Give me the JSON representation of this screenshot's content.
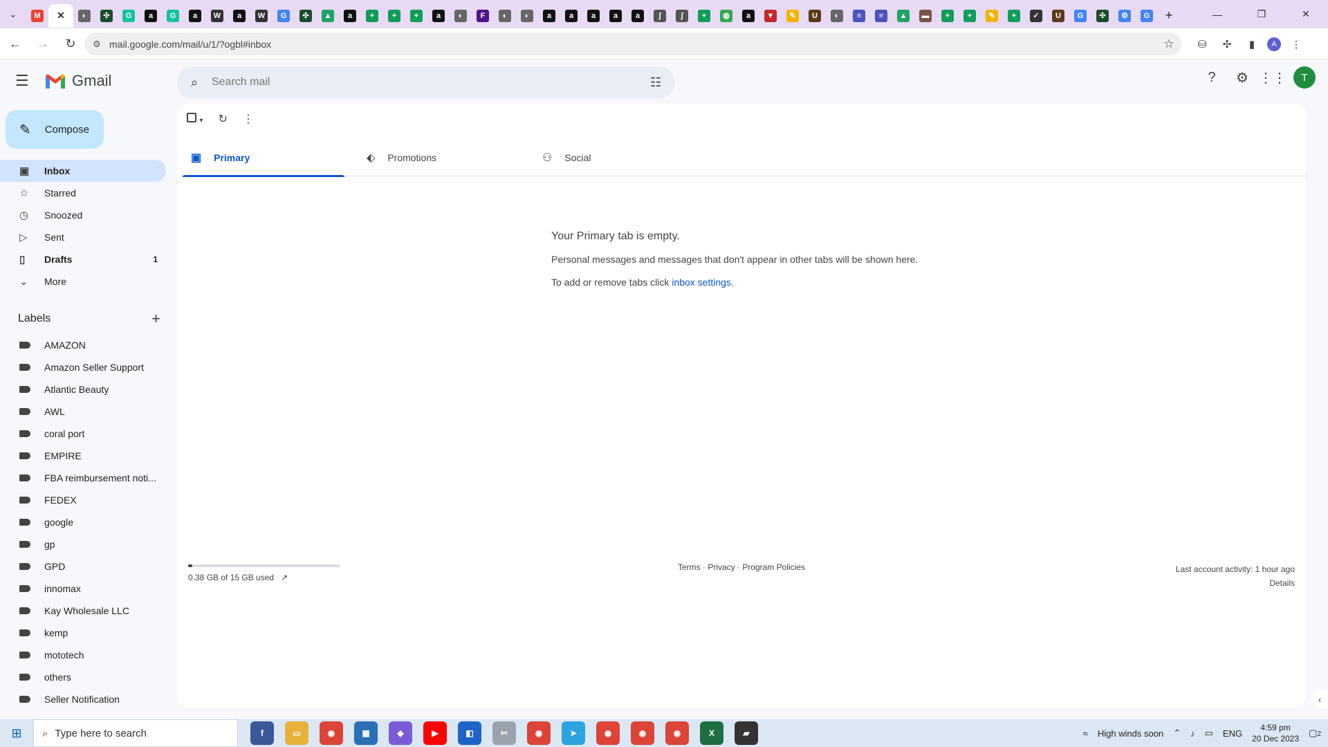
{
  "browser": {
    "url": "mail.google.com/mail/u/1/?ogbl#inbox",
    "tab_icons": [
      "gmail-icon",
      "close-icon",
      "globe-icon",
      "puzzle-icon",
      "grammarly-icon",
      "amazon-icon",
      "grammarly-icon",
      "amazon-icon",
      "wix-icon",
      "amazon-icon",
      "wix-icon",
      "google-icon",
      "puzzle-icon",
      "drive-icon",
      "amazon-icon",
      "sheets-icon",
      "sheets-icon",
      "sheets-icon",
      "amazon-icon",
      "globe-icon",
      "fedex-icon",
      "globe-icon",
      "globe-icon",
      "amazon-icon",
      "amazon-icon",
      "amazon-icon",
      "amazon-icon",
      "amazon-icon",
      "script-icon",
      "script-icon",
      "sheets-icon",
      "maps-icon",
      "amazon-icon",
      "vault-icon",
      "pen-icon",
      "ups-icon",
      "globe-icon",
      "docs-icon",
      "docs-icon",
      "drive-icon",
      "box-icon",
      "sheets-icon",
      "sheets-icon",
      "pen-icon",
      "sheets-icon",
      "check-icon",
      "ups-icon",
      "google-icon",
      "puzzle-icon",
      "gear-icon",
      "google-icon"
    ],
    "profile_initial": "A"
  },
  "gmail": {
    "product_name": "Gmail",
    "search_placeholder": "Search mail",
    "avatar_initial": "T",
    "compose_label": "Compose",
    "nav": [
      {
        "label": "Inbox",
        "icon": "inbox-icon",
        "count": "",
        "active": true
      },
      {
        "label": "Starred",
        "icon": "star-icon",
        "count": "",
        "active": false
      },
      {
        "label": "Snoozed",
        "icon": "clock-icon",
        "count": "",
        "active": false
      },
      {
        "label": "Sent",
        "icon": "send-icon",
        "count": "",
        "active": false
      },
      {
        "label": "Drafts",
        "icon": "draft-icon",
        "count": "1",
        "active": false
      },
      {
        "label": "More",
        "icon": "chevron-down-icon",
        "count": "",
        "active": false
      }
    ],
    "labels_heading": "Labels",
    "labels": [
      "AMAZON",
      "Amazon Seller Support",
      "Atlantic Beauty",
      "AWL",
      "coral port",
      "EMPIRE",
      "FBA reimbursement noti...",
      "FEDEX",
      "google",
      "gp",
      "GPD",
      "innomax",
      "Kay Wholesale LLC",
      "kemp",
      "mototech",
      "others",
      "Seller Notification"
    ],
    "tabs": [
      {
        "label": "Primary",
        "icon": "inbox-icon",
        "active": true
      },
      {
        "label": "Promotions",
        "icon": "tag-icon",
        "active": false
      },
      {
        "label": "Social",
        "icon": "people-icon",
        "active": false
      }
    ],
    "empty_title": "Your Primary tab is empty.",
    "empty_line1": "Personal messages and messages that don't appear in other tabs will be shown here.",
    "empty_line2_prefix": "To add or remove tabs click ",
    "empty_line2_link": "inbox settings",
    "empty_line2_suffix": ".",
    "storage_text": "0.38 GB of 15 GB used",
    "storage_fraction": 0.025,
    "footer_links": "Terms · Privacy · Program Policies",
    "last_activity": "Last account activity: 1 hour ago",
    "details_link": "Details"
  },
  "taskbar": {
    "search_placeholder": "Type here to search",
    "weather": "High winds soon",
    "lang": "ENG",
    "time": "4:59 pm",
    "date": "20 Dec 2023",
    "notifications": "2"
  },
  "colors": {
    "accent": "#0b57d0",
    "compose_bg": "#c2e7ff",
    "active_nav": "#d3e3fd",
    "tabstrip": "#e8d9f5",
    "avatar": "#1e8e3e"
  }
}
